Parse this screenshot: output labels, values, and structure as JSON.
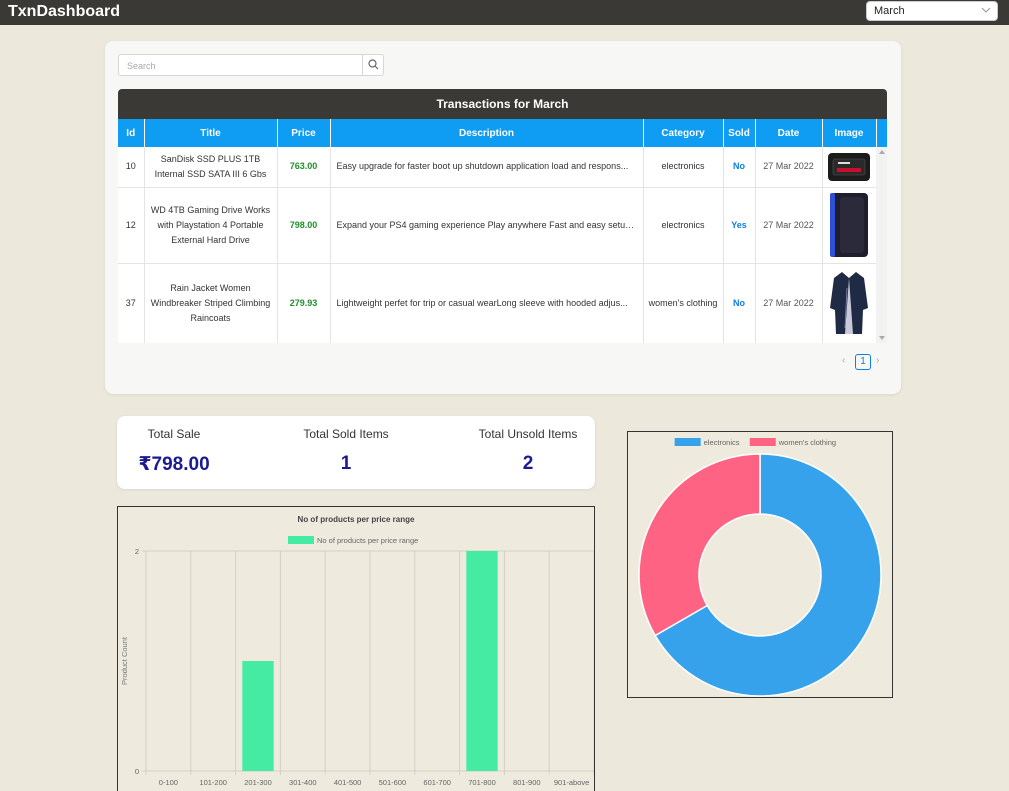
{
  "header": {
    "brand": "TxnDashboard",
    "month_selected": "March"
  },
  "search": {
    "placeholder": "Search"
  },
  "table": {
    "title": "Transactions for March",
    "columns": [
      "Id",
      "Title",
      "Price",
      "Description",
      "Category",
      "Sold",
      "Date",
      "Image"
    ],
    "rows": [
      {
        "id": "10",
        "title": "SanDisk SSD PLUS 1TB Internal SSD SATA III 6 Gbs",
        "price": "763.00",
        "description": "Easy upgrade for faster boot up shutdown application load and respons...",
        "category": "electronics",
        "sold": "No",
        "date": "27 Mar 2022",
        "image": "ssd-image"
      },
      {
        "id": "12",
        "title": "WD 4TB Gaming Drive Works with Playstation 4 Portable External Hard Drive",
        "price": "798.00",
        "description": "Expand your PS4 gaming experience Play anywhere Fast and easy setup ...",
        "category": "electronics",
        "sold": "Yes",
        "date": "27 Mar 2022",
        "image": "hard-drive-image"
      },
      {
        "id": "37",
        "title": "Rain Jacket Women Windbreaker Striped Climbing Raincoats",
        "price": "279.93",
        "description": "Lightweight perfet for trip or casual wearLong sleeve with hooded adjus...",
        "category": "women's clothing",
        "sold": "No",
        "date": "27 Mar 2022",
        "image": "jacket-image"
      }
    ]
  },
  "pagination": {
    "prev": "‹",
    "current_page": "1",
    "next": "›"
  },
  "stats": {
    "total_sale_label": "Total Sale",
    "total_sale_value": "₹798.00",
    "sold_label": "Total Sold Items",
    "sold_value": "1",
    "unsold_label": "Total Unsold Items",
    "unsold_value": "2"
  },
  "chart_data": [
    {
      "type": "bar",
      "title": "No of products per price range",
      "ylabel": "Product Count",
      "xlabel": "",
      "categories": [
        "0-100",
        "101-200",
        "201-300",
        "301-400",
        "401-500",
        "501-600",
        "601-700",
        "701-800",
        "801-900",
        "901-above"
      ],
      "series": [
        {
          "name": "No of products per price range",
          "values": [
            0,
            0,
            1,
            0,
            0,
            0,
            0,
            2,
            0,
            0
          ],
          "color": "#45eaa3"
        }
      ],
      "ylim": [
        0,
        2
      ],
      "yticks": [
        "0",
        "2"
      ],
      "grid": true,
      "legend": "top"
    },
    {
      "type": "pie",
      "donut": true,
      "categories": [
        "electronics",
        "women's clothing"
      ],
      "values": [
        2,
        1
      ],
      "colors": [
        "#36a2eb",
        "#ff6384"
      ],
      "legend": "top"
    }
  ]
}
